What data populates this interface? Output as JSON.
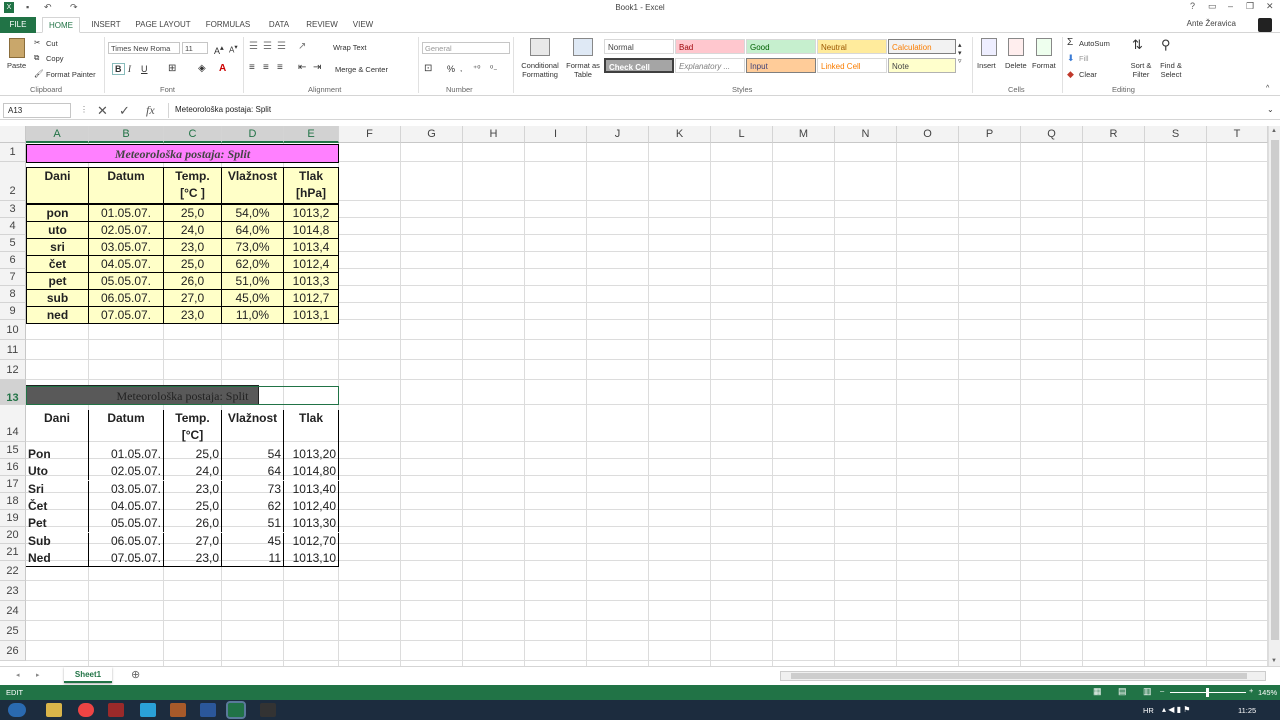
{
  "window": {
    "title": "Book1 - Excel",
    "user": "Ante Žeravica"
  },
  "tabs": [
    "FILE",
    "HOME",
    "INSERT",
    "PAGE LAYOUT",
    "FORMULAS",
    "DATA",
    "REVIEW",
    "VIEW"
  ],
  "ribbon": {
    "clipboard": {
      "paste": "Paste",
      "cut": "Cut",
      "copy": "Copy",
      "format_painter": "Format Painter",
      "label": "Clipboard"
    },
    "font": {
      "name": "Times New Roma",
      "size": "11",
      "label": "Font",
      "bold": "B",
      "italic": "I",
      "underline": "U"
    },
    "alignment": {
      "wrap": "Wrap Text",
      "merge": "Merge & Center",
      "label": "Alignment"
    },
    "number": {
      "format": "General",
      "label": "Number",
      "percent": "%"
    },
    "styles": {
      "cond": "Conditional Formatting",
      "table": "Format as Table",
      "label": "Styles",
      "cells": [
        "Normal",
        "Bad",
        "Good",
        "Neutral",
        "Calculation",
        "Check Cell",
        "Explanatory ...",
        "Input",
        "Linked Cell",
        "Note"
      ]
    },
    "cells": {
      "insert": "Insert",
      "delete": "Delete",
      "format": "Format",
      "label": "Cells"
    },
    "editing": {
      "autosum": "AutoSum",
      "fill": "Fill",
      "clear": "Clear",
      "sort": "Sort & Filter",
      "find": "Find & Select",
      "label": "Editing"
    }
  },
  "formula": {
    "namebox": "A13",
    "content": "Meteorološka postaja: Split",
    "fx": "fx"
  },
  "columns": [
    "A",
    "B",
    "C",
    "D",
    "E",
    "F",
    "G",
    "H",
    "I",
    "J",
    "K",
    "L",
    "M",
    "N",
    "O",
    "P",
    "Q",
    "R",
    "S",
    "T"
  ],
  "rows": [
    "1",
    "2",
    "3",
    "4",
    "5",
    "6",
    "7",
    "8",
    "9",
    "10",
    "11",
    "12",
    "13",
    "14",
    "15",
    "16",
    "17",
    "18",
    "19",
    "20",
    "21",
    "22",
    "23",
    "24",
    "25",
    "26"
  ],
  "table1": {
    "title": "Meteorološka postaja: Split",
    "headers": [
      "Dani",
      "Datum",
      "Temp.",
      "[°C ]",
      "Vlažnost",
      "Tlak",
      "[hPa]"
    ],
    "rows": [
      [
        "pon",
        "01.05.07.",
        "25,0",
        "54,0%",
        "1013,2"
      ],
      [
        "uto",
        "02.05.07.",
        "24,0",
        "64,0%",
        "1014,8"
      ],
      [
        "sri",
        "03.05.07.",
        "23,0",
        "73,0%",
        "1013,4"
      ],
      [
        "čet",
        "04.05.07.",
        "25,0",
        "62,0%",
        "1012,4"
      ],
      [
        "pet",
        "05.05.07.",
        "26,0",
        "51,0%",
        "1013,3"
      ],
      [
        "sub",
        "06.05.07.",
        "27,0",
        "45,0%",
        "1012,7"
      ],
      [
        "ned",
        "07.05.07.",
        "23,0",
        "11,0%",
        "1013,1"
      ]
    ]
  },
  "table2": {
    "title": "Meteorološka postaja: Split",
    "headers": [
      "Dani",
      "Datum",
      "Temp.",
      "[°C]",
      "Vlažnost",
      "Tlak"
    ],
    "rows": [
      [
        "Pon",
        "01.05.07.",
        "25,0",
        "54",
        "1013,20"
      ],
      [
        "Uto",
        "02.05.07.",
        "24,0",
        "64",
        "1014,80"
      ],
      [
        "Sri",
        "03.05.07.",
        "23,0",
        "73",
        "1013,40"
      ],
      [
        "Čet",
        "04.05.07.",
        "25,0",
        "62",
        "1012,40"
      ],
      [
        "Pet",
        "05.05.07.",
        "26,0",
        "51",
        "1013,30"
      ],
      [
        "Sub",
        "06.05.07.",
        "27,0",
        "45",
        "1012,70"
      ],
      [
        "Ned",
        "07.05.07.",
        "23,0",
        "11",
        "1013,10"
      ]
    ]
  },
  "sheet": {
    "tab": "Sheet1"
  },
  "status": {
    "mode": "EDIT",
    "zoom": "145%"
  },
  "taskbar": {
    "lang": "HR",
    "time": "11:25"
  },
  "colors": {
    "excel_green": "#217346",
    "title_fill": "#ff80ff",
    "table_fill": "#ffffc8",
    "selected_title": "#595959"
  }
}
